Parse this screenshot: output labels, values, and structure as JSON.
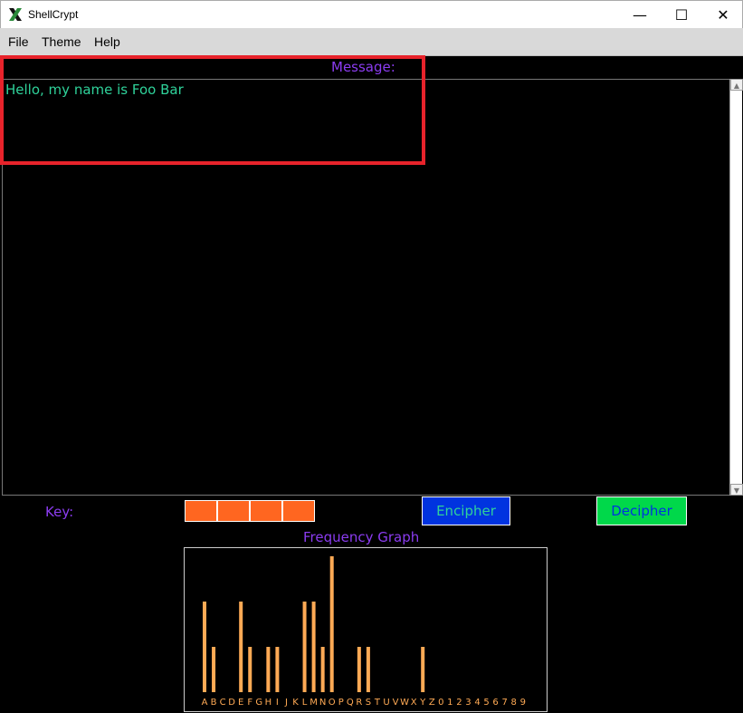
{
  "window": {
    "title": "ShellCrypt",
    "minimize_glyph": "—",
    "maximize_glyph": "☐",
    "close_glyph": "✕"
  },
  "menu": {
    "file": "File",
    "theme": "Theme",
    "help": "Help"
  },
  "message": {
    "label": "Message:",
    "text": "Hello, my name is Foo Bar"
  },
  "key": {
    "label": "Key:",
    "values": [
      "",
      "",
      "",
      ""
    ]
  },
  "buttons": {
    "encipher": "Encipher",
    "decipher": "Decipher"
  },
  "colors": {
    "label_purple": "#8b3cf0",
    "text_green": "#2fd29a",
    "key_orange": "#ff6620",
    "encipher_bg": "#0033e0",
    "decipher_bg": "#00d84a",
    "bar_color": "#ffaa55",
    "highlight_red": "#e8232b"
  },
  "icons": {
    "app": "x-logo-icon",
    "scroll_up": "triangle-up-icon",
    "scroll_down": "triangle-down-icon"
  },
  "chart_data": {
    "type": "bar",
    "title": "Frequency Graph",
    "categories": [
      "A",
      "B",
      "C",
      "D",
      "E",
      "F",
      "G",
      "H",
      "I",
      "J",
      "K",
      "L",
      "M",
      "N",
      "O",
      "P",
      "Q",
      "R",
      "S",
      "T",
      "U",
      "V",
      "W",
      "X",
      "Y",
      "Z",
      "0",
      "1",
      "2",
      "3",
      "4",
      "5",
      "6",
      "7",
      "8",
      "9"
    ],
    "values": [
      2,
      1,
      0,
      0,
      2,
      1,
      0,
      1,
      1,
      0,
      0,
      2,
      2,
      1,
      3,
      0,
      0,
      1,
      1,
      0,
      0,
      0,
      0,
      0,
      1,
      0,
      0,
      0,
      0,
      0,
      0,
      0,
      0,
      0,
      0,
      0
    ],
    "xlabel": "",
    "ylabel": "",
    "ylim": [
      0,
      3
    ],
    "grid": false
  }
}
